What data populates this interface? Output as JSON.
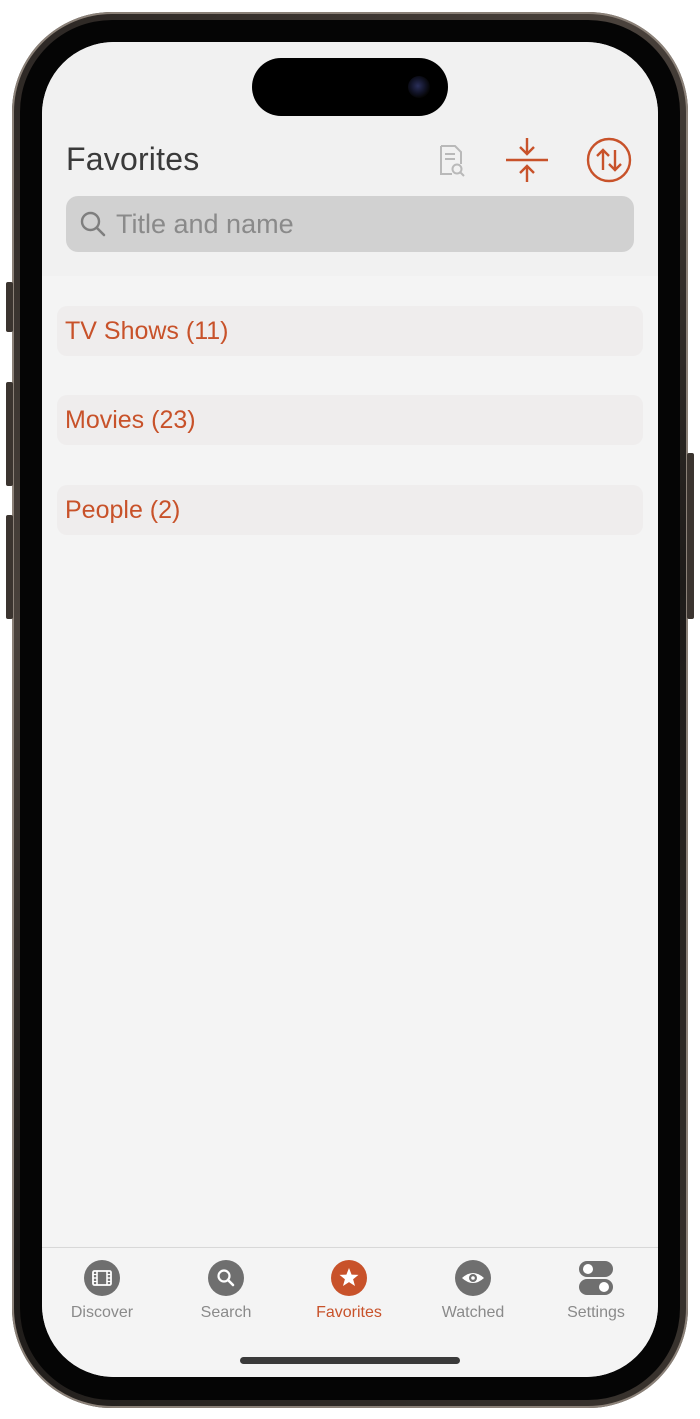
{
  "header": {
    "title": "Favorites",
    "icons": [
      "document-search-icon",
      "collapse-icon",
      "sort-icon"
    ]
  },
  "search": {
    "placeholder": "Title and name",
    "value": ""
  },
  "sections": [
    {
      "label": "TV Shows (11)"
    },
    {
      "label": "Movies (23)"
    },
    {
      "label": "People (2)"
    }
  ],
  "tabs": [
    {
      "label": "Discover",
      "icon": "film-icon",
      "active": false
    },
    {
      "label": "Search",
      "icon": "search-icon",
      "active": false
    },
    {
      "label": "Favorites",
      "icon": "star-icon",
      "active": true
    },
    {
      "label": "Watched",
      "icon": "eye-icon",
      "active": false
    },
    {
      "label": "Settings",
      "icon": "toggles-icon",
      "active": false
    }
  ],
  "colors": {
    "accent": "#c8522a",
    "inactive": "#6f6f6f",
    "background": "#f4f4f4"
  }
}
